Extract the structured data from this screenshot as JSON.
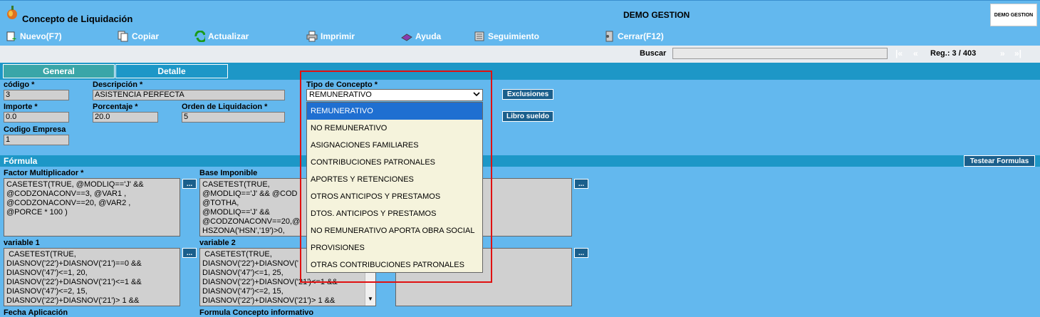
{
  "window": {
    "title": "Concepto de Liquidación",
    "center_title": "DEMO GESTION",
    "logo_text": "DEMO GESTION"
  },
  "toolbar": {
    "nuevo": "Nuevo(F7)",
    "copiar": "Copiar",
    "actualizar": "Actualizar",
    "imprimir": "Imprimir",
    "ayuda": "Ayuda",
    "seguimiento": "Seguimiento",
    "cerrar": "Cerrar(F12)"
  },
  "search": {
    "label": "Buscar",
    "value": "",
    "first": "|«",
    "prev": "«",
    "next": "»",
    "last": "»|",
    "record": "Reg.: 3 / 403"
  },
  "tabs": {
    "general": "General",
    "detalle": "Detalle"
  },
  "form": {
    "codigo_label": "código *",
    "codigo_value": "3",
    "descripcion_label": "Descripción *",
    "descripcion_value": "ASISTENCIA PERFECTA",
    "importe_label": "Importe *",
    "importe_value": "0.0",
    "porcentaje_label": "Porcentaje *",
    "porcentaje_value": "20.0",
    "orden_label": "Orden de Liquidacion *",
    "orden_value": "5",
    "empresa_label": "Codigo Empresa",
    "empresa_value": "1",
    "tipo_label": "Tipo de Concepto *",
    "tipo_value": "REMUNERATIVO",
    "exclusiones": "Exclusiones",
    "libro_sueldo": "Libro sueldo"
  },
  "tipo_options": [
    "REMUNERATIVO",
    "NO REMUNERATIVO",
    "ASIGNACIONES FAMILIARES",
    "CONTRIBUCIONES PATRONALES",
    "APORTES Y RETENCIONES",
    "OTROS ANTICIPOS Y PRESTAMOS",
    "DTOS. ANTICIPOS Y PRESTAMOS",
    "NO REMUNERATIVO APORTA OBRA SOCIAL",
    "PROVISIONES",
    "OTRAS CONTRIBUCIONES PATRONALES"
  ],
  "formula": {
    "section_title": "Fórmula",
    "testear": "Testear Formulas",
    "dots": "...",
    "factor_label": "Factor Multiplicador *",
    "factor_value": "CASETEST(TRUE, @MODLIQ=='J' &&\n@CODZONACONV==3, @VAR1 ,\n@CODZONACONV==20, @VAR2 ,\n@PORCE * 100 )",
    "base_label": "Base Imponible",
    "base_value": "CASETEST(TRUE,\n@MODLIQ=='J' && @COD\n@TOTHA,\n@MODLIQ=='J' &&\n@CODZONACONV==20,@\nHSZONA('HSN','19')>0,",
    "var1_label": "variable 1",
    "var1_value": " CASETEST(TRUE,\nDIASNOV('22')+DIASNOV('21')==0 &&\nDIASNOV('47')<=1, 20,\nDIASNOV('22')+DIASNOV('21')<=1 &&\nDIASNOV('47')<=2, 15,\nDIASNOV('22')+DIASNOV('21')> 1 &&",
    "var2_label": "variable 2",
    "var2_value": " CASETEST(TRUE,\nDIASNOV('22')+DIASNOV('\nDIASNOV('47')<=1, 25,\nDIASNOV('22')+DIASNOV('21')<=1 &&\nDIASNOV('47')<=2, 15,\nDIASNOV('22')+DIASNOV('21')> 1 &&",
    "fecha_label": "Fecha Aplicación",
    "informativo_label": "Formula Concepto informativo"
  }
}
